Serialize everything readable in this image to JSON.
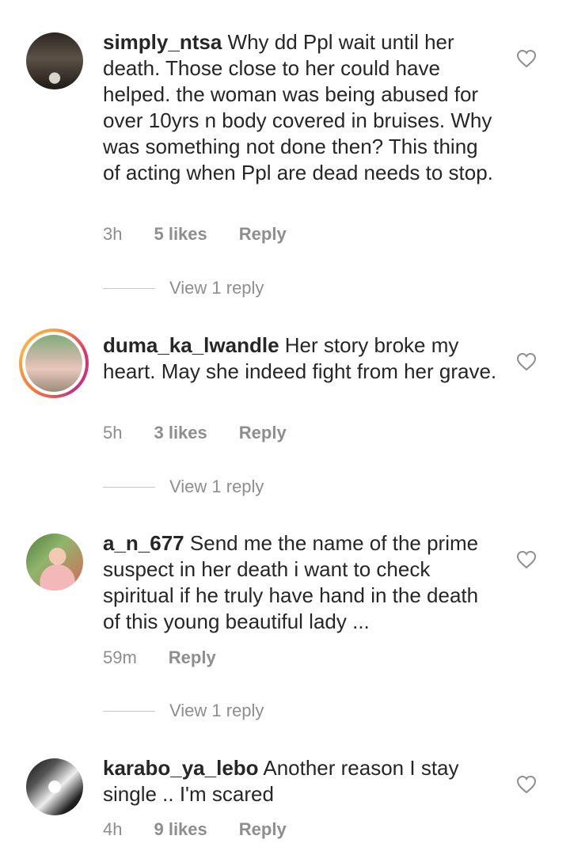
{
  "comments": [
    {
      "username": "simply_ntsa",
      "text": "Why dd Ppl wait until her death. Those close to her could have helped. the woman was being abused for over 10yrs n body covered in bruises. Why was something not done then? This thing of acting when Ppl are dead needs to stop.",
      "time": "3h",
      "likes": "5 likes",
      "reply": "Reply",
      "view_replies": "View 1 reply"
    },
    {
      "username": "duma_ka_lwandle",
      "text": "Her story broke my heart. May she indeed fight from her grave.",
      "time": "5h",
      "likes": "3 likes",
      "reply": "Reply",
      "view_replies": "View 1 reply"
    },
    {
      "username": "a_n_677",
      "text": "Send me the name of the prime suspect in her death i want to check spiritual if he truly have hand in the death of this young beautiful lady ...",
      "time": "59m",
      "likes": "",
      "reply": "Reply",
      "view_replies": "View 1 reply"
    },
    {
      "username": "karabo_ya_lebo",
      "text": "Another reason I stay single .. I'm scared",
      "time": "4h",
      "likes": "9 likes",
      "reply": "Reply"
    }
  ],
  "icons": {
    "like": "heart-outline-icon"
  },
  "colors": {
    "text": "#262626",
    "muted": "#8e8e8e"
  }
}
